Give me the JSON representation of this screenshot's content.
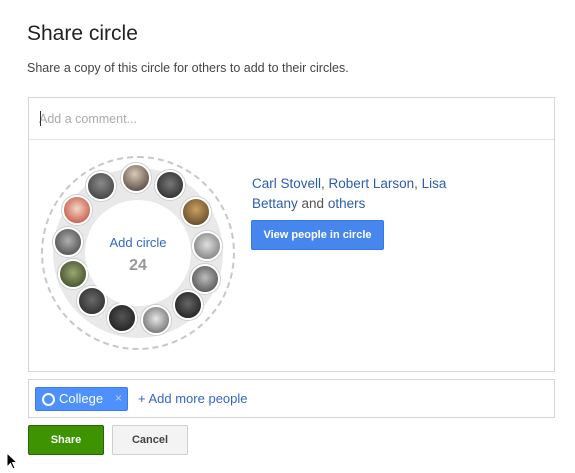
{
  "dialog": {
    "title": "Share circle",
    "subtitle": "Share a copy of this circle for others to add to their circles."
  },
  "comment": {
    "placeholder": "Add a comment..."
  },
  "circle": {
    "name": "Add circle",
    "count": "24"
  },
  "people": {
    "name1": "Carl Stovell",
    "sep1": ", ",
    "name2": "Robert Larson",
    "sep2": ", ",
    "name3": "Lisa Bettany",
    "and_text": " and ",
    "others_label": "others"
  },
  "view_button_label": "View people in circle",
  "recipients": {
    "chip_label": "College",
    "chip_remove": "×",
    "add_more_label": "+ Add more people"
  },
  "actions": {
    "share_label": "Share",
    "cancel_label": "Cancel"
  },
  "colors": {
    "primary_blue": "#4787ed",
    "link_blue": "#3366cc",
    "share_green": "#3d9400",
    "chip_blue": "#4d90fe"
  }
}
